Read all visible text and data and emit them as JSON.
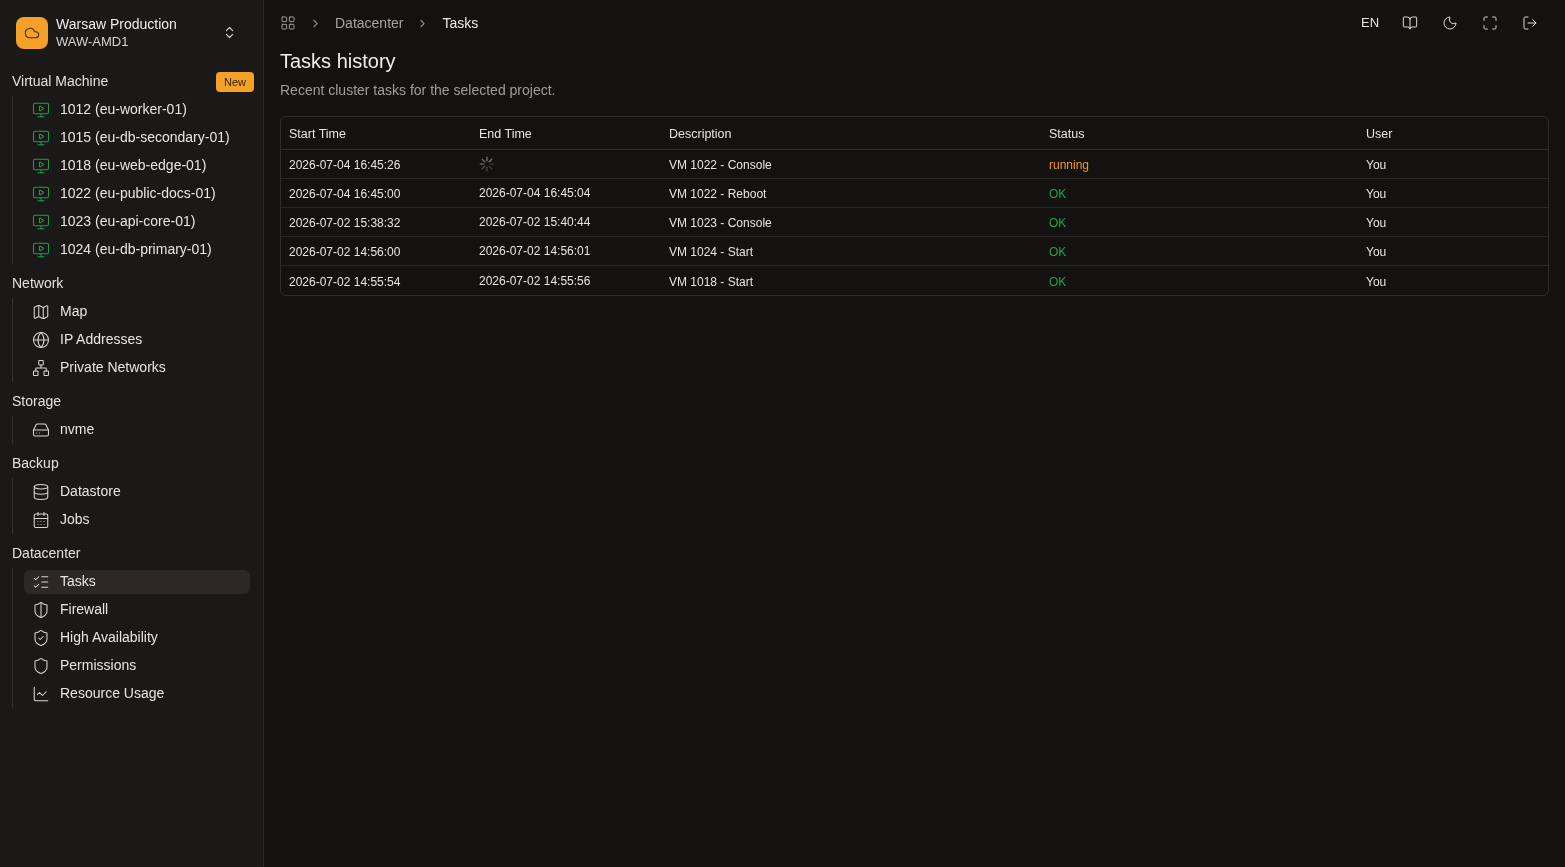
{
  "workspace": {
    "name": "Warsaw Production",
    "subtitle": "WAW-AMD1"
  },
  "sidebar": {
    "sections": [
      {
        "title": "Virtual Machine",
        "badge": "New",
        "items": [
          {
            "label": "1012 (eu-worker-01)",
            "selected": false
          },
          {
            "label": "1015 (eu-db-secondary-01)",
            "selected": false
          },
          {
            "label": "1018 (eu-web-edge-01)",
            "selected": false
          },
          {
            "label": "1022 (eu-public-docs-01)",
            "selected": false
          },
          {
            "label": "1023 (eu-api-core-01)",
            "selected": false
          },
          {
            "label": "1024 (eu-db-primary-01)",
            "selected": false
          }
        ]
      },
      {
        "title": "Network",
        "items": [
          {
            "label": "Map",
            "selected": false
          },
          {
            "label": "IP Addresses",
            "selected": false
          },
          {
            "label": "Private Networks",
            "selected": false
          }
        ]
      },
      {
        "title": "Storage",
        "items": [
          {
            "label": "nvme",
            "selected": false
          }
        ]
      },
      {
        "title": "Backup",
        "items": [
          {
            "label": "Datastore",
            "selected": false
          },
          {
            "label": "Jobs",
            "selected": false
          }
        ]
      },
      {
        "title": "Datacenter",
        "items": [
          {
            "label": "Tasks",
            "selected": true
          },
          {
            "label": "Firewall",
            "selected": false
          },
          {
            "label": "High Availability",
            "selected": false
          },
          {
            "label": "Permissions",
            "selected": false
          },
          {
            "label": "Resource Usage",
            "selected": false
          }
        ]
      }
    ]
  },
  "breadcrumb": [
    "Datacenter",
    "Tasks"
  ],
  "toolbar": {
    "language": "EN"
  },
  "page": {
    "title": "Tasks history",
    "subtitle": "Recent cluster tasks for the selected project."
  },
  "table": {
    "columns": [
      "Start Time",
      "End Time",
      "Description",
      "Status",
      "User"
    ],
    "rows": [
      {
        "start_time": "2026-07-04 16:45:26",
        "in_progress": true,
        "description": "VM 1022 - Console",
        "status": "running",
        "kind": "running",
        "user": "You"
      },
      {
        "start_time": "2026-07-04 16:45:00",
        "end_time": "2026-07-04 16:45:04",
        "in_progress": false,
        "description": "VM 1022 - Reboot",
        "status": "OK",
        "kind": "ok",
        "user": "You"
      },
      {
        "start_time": "2026-07-02 15:38:32",
        "end_time": "2026-07-02 15:40:44",
        "in_progress": false,
        "description": "VM 1023 - Console",
        "status": "OK",
        "kind": "ok",
        "user": "You"
      },
      {
        "start_time": "2026-07-02 14:56:00",
        "end_time": "2026-07-02 14:56:01",
        "in_progress": false,
        "description": "VM 1024 - Start",
        "status": "OK",
        "kind": "ok",
        "user": "You"
      },
      {
        "start_time": "2026-07-02 14:55:54",
        "end_time": "2026-07-02 14:55:56",
        "in_progress": false,
        "description": "VM 1018 - Start",
        "status": "OK",
        "kind": "ok",
        "user": "You"
      }
    ]
  }
}
